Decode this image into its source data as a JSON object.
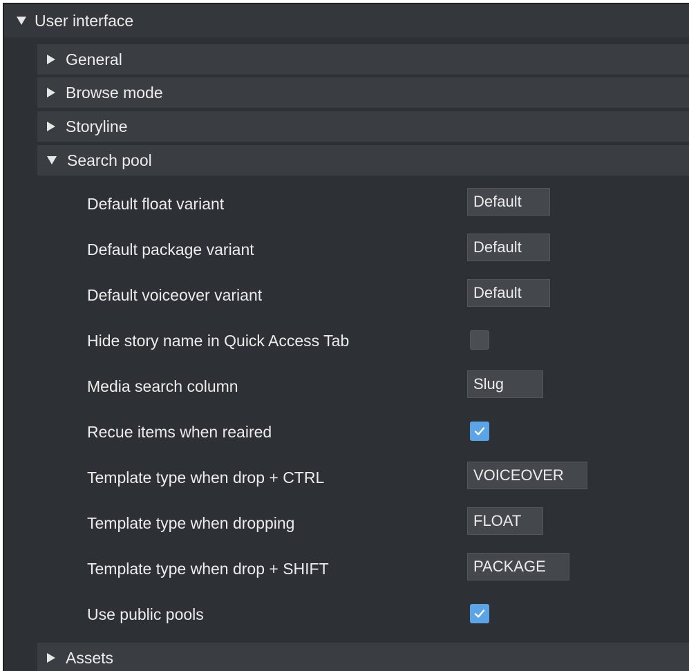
{
  "sections": {
    "user_interface": "User interface",
    "general": "General",
    "browse_mode": "Browse mode",
    "storyline": "Storyline",
    "search_pool": "Search pool",
    "assets": "Assets"
  },
  "settings": {
    "default_float_variant": {
      "label": "Default float variant",
      "value": "Default"
    },
    "default_package_variant": {
      "label": "Default package variant",
      "value": "Default"
    },
    "default_voiceover_variant": {
      "label": "Default voiceover variant",
      "value": "Default"
    },
    "hide_story_name": {
      "label": "Hide story name in Quick Access Tab",
      "checked": false
    },
    "media_search_column": {
      "label": "Media search column",
      "value": "Slug"
    },
    "recue_items": {
      "label": "Recue items when reaired",
      "checked": true
    },
    "template_drop_ctrl": {
      "label": "Template type when drop + CTRL",
      "value": "VOICEOVER"
    },
    "template_dropping": {
      "label": "Template type when dropping",
      "value": "FLOAT"
    },
    "template_drop_shift": {
      "label": "Template type when drop + SHIFT",
      "value": "PACKAGE"
    },
    "use_public_pools": {
      "label": "Use public pools",
      "checked": true
    }
  },
  "colors": {
    "background": "#2d3035",
    "section_header": "#3a3d42",
    "checkbox_checked": "#5ba5e6"
  }
}
